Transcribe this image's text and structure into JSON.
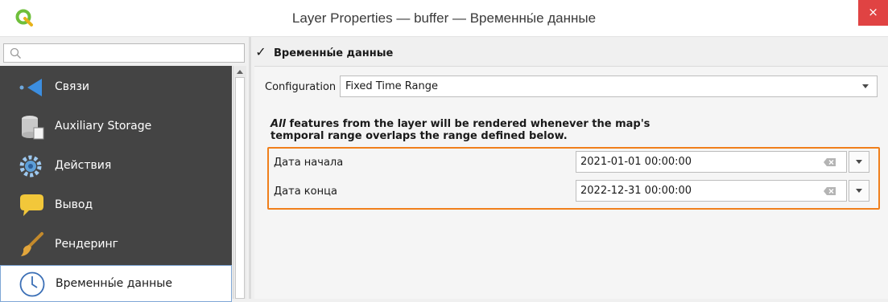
{
  "window": {
    "title": "Layer Properties — buffer — Временны́е данные",
    "close_glyph": "×"
  },
  "search": {
    "placeholder": ""
  },
  "sidebar": {
    "items": [
      {
        "label": "Связи",
        "icon": "relations-icon"
      },
      {
        "label": "Auxiliary Storage",
        "icon": "auxiliary-storage-icon"
      },
      {
        "label": "Действия",
        "icon": "actions-gear-icon"
      },
      {
        "label": "Вывод",
        "icon": "display-tip-icon"
      },
      {
        "label": "Рендеринг",
        "icon": "rendering-brush-icon"
      },
      {
        "label": "Временны́е данные",
        "icon": "temporal-clock-icon",
        "selected": true
      }
    ]
  },
  "temporal": {
    "enabled": true,
    "check_glyph": "✓",
    "group_title": "Временны́е данные",
    "configuration_label": "Configuration",
    "configuration_value": "Fixed Time Range",
    "description_emphasis": "All",
    "description_rest": " features from the layer will be rendered whenever the map's temporal range overlaps the range defined below.",
    "start_label": "Дата начала",
    "start_value": "2021-01-01 00:00:00",
    "end_label": "Дата конца",
    "end_value": "2022-12-31 00:00:00"
  },
  "colors": {
    "sidebar_bg": "#444444",
    "highlight_border": "#f07f1b",
    "close_button": "#e04343",
    "qgis_logo": "#6fbf3b"
  }
}
